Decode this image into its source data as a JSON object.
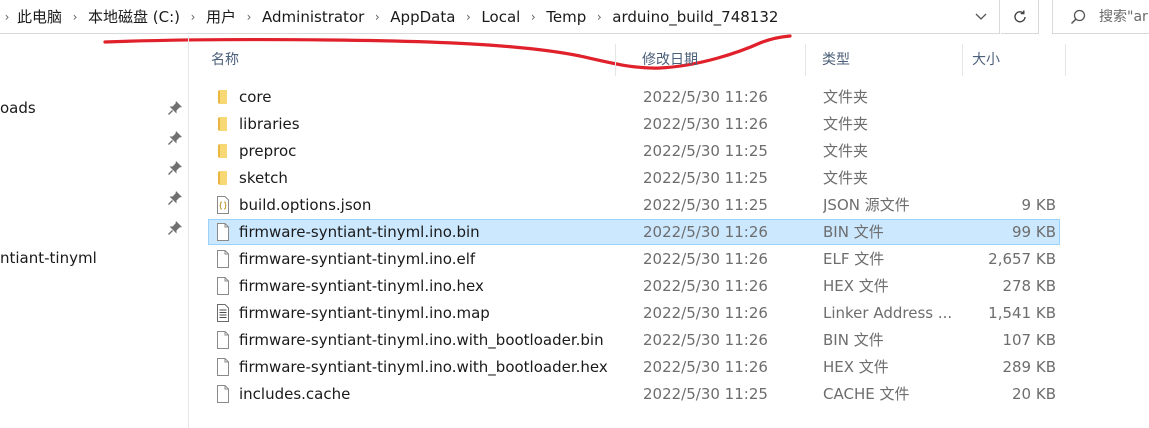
{
  "address_bar": {
    "crumbs": [
      "此电脑",
      "本地磁盘 (C:)",
      "用户",
      "Administrator",
      "AppData",
      "Local",
      "Temp",
      "arduino_build_748132"
    ]
  },
  "search": {
    "placeholder": "搜索\"ar"
  },
  "nav": {
    "items": [
      {
        "label": "oads",
        "pinned": true
      },
      {
        "label": "",
        "pinned": true
      },
      {
        "label": "",
        "pinned": true
      },
      {
        "label": "",
        "pinned": true
      },
      {
        "label": "",
        "pinned": true
      },
      {
        "label": "ntiant-tinyml",
        "pinned": false
      }
    ]
  },
  "columns": {
    "name": "名称",
    "date": "修改日期",
    "type": "类型",
    "size": "大小"
  },
  "files": [
    {
      "name": "core",
      "date": "2022/5/30 11:26",
      "type": "文件夹",
      "size": "",
      "icon": "folder-icon"
    },
    {
      "name": "libraries",
      "date": "2022/5/30 11:26",
      "type": "文件夹",
      "size": "",
      "icon": "folder-icon"
    },
    {
      "name": "preproc",
      "date": "2022/5/30 11:25",
      "type": "文件夹",
      "size": "",
      "icon": "folder-icon"
    },
    {
      "name": "sketch",
      "date": "2022/5/30 11:25",
      "type": "文件夹",
      "size": "",
      "icon": "folder-icon"
    },
    {
      "name": "build.options.json",
      "date": "2022/5/30 11:25",
      "type": "JSON 源文件",
      "size": "9 KB",
      "icon": "json-file-icon"
    },
    {
      "name": "firmware-syntiant-tinyml.ino.bin",
      "date": "2022/5/30 11:26",
      "type": "BIN 文件",
      "size": "99 KB",
      "icon": "file-icon",
      "selected": true
    },
    {
      "name": "firmware-syntiant-tinyml.ino.elf",
      "date": "2022/5/30 11:26",
      "type": "ELF 文件",
      "size": "2,657 KB",
      "icon": "file-icon"
    },
    {
      "name": "firmware-syntiant-tinyml.ino.hex",
      "date": "2022/5/30 11:26",
      "type": "HEX 文件",
      "size": "278 KB",
      "icon": "file-icon"
    },
    {
      "name": "firmware-syntiant-tinyml.ino.map",
      "date": "2022/5/30 11:26",
      "type": "Linker Address ...",
      "size": "1,541 KB",
      "icon": "text-file-icon"
    },
    {
      "name": "firmware-syntiant-tinyml.ino.with_bootloader.bin",
      "date": "2022/5/30 11:26",
      "type": "BIN 文件",
      "size": "107 KB",
      "icon": "file-icon"
    },
    {
      "name": "firmware-syntiant-tinyml.ino.with_bootloader.hex",
      "date": "2022/5/30 11:26",
      "type": "HEX 文件",
      "size": "289 KB",
      "icon": "file-icon"
    },
    {
      "name": "includes.cache",
      "date": "2022/5/30 11:25",
      "type": "CACHE 文件",
      "size": "20 KB",
      "icon": "file-icon"
    }
  ],
  "colors": {
    "selection_bg": "#cce8ff",
    "selection_border": "#99d1ff",
    "header_text": "#4c607a",
    "folder": "#f8d775",
    "annotation": "#e0202a"
  }
}
